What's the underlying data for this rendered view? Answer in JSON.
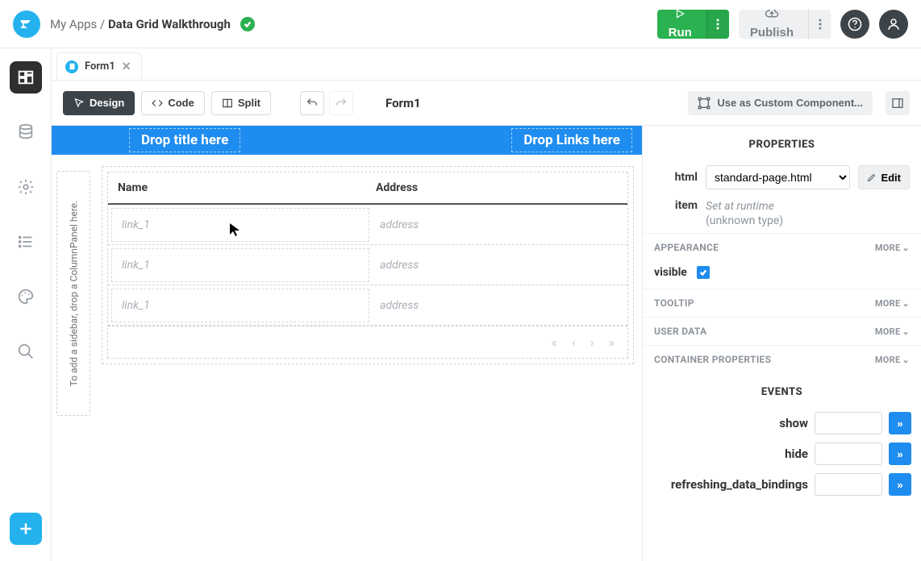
{
  "breadcrumb": {
    "root": "My Apps",
    "sep": " / ",
    "current": "Data Grid Walkthrough"
  },
  "topbar": {
    "run": "Run",
    "publish": "Publish"
  },
  "tab": {
    "name": "Form1"
  },
  "toolbar": {
    "design": "Design",
    "code": "Code",
    "split": "Split",
    "form": "Form1",
    "custom": "Use as Custom Component..."
  },
  "canvas": {
    "hero_title": "Drop title here",
    "hero_links": "Drop Links here",
    "sidebar_hint": "To add a sidebar, drop a ColumnPanel here.",
    "columns": {
      "name": "Name",
      "address": "Address"
    },
    "rows": [
      {
        "link": "link_1",
        "address": "address"
      },
      {
        "link": "link_1",
        "address": "address"
      },
      {
        "link": "link_1",
        "address": "address"
      }
    ]
  },
  "props": {
    "heading": "PROPERTIES",
    "html_label": "html",
    "html_value": "standard-page.html",
    "edit": "Edit",
    "item_label": "item",
    "item_line1": "Set at runtime",
    "item_line2": "(unknown type)",
    "sections": {
      "appearance": "APPEARANCE",
      "tooltip": "TOOLTIP",
      "userdata": "USER DATA",
      "container": "CONTAINER PROPERTIES",
      "more": "MORE"
    },
    "visible_label": "visible",
    "events_heading": "EVENTS",
    "events": {
      "show": "show",
      "hide": "hide",
      "refresh": "refreshing_data_bindings",
      "go": "»"
    }
  }
}
